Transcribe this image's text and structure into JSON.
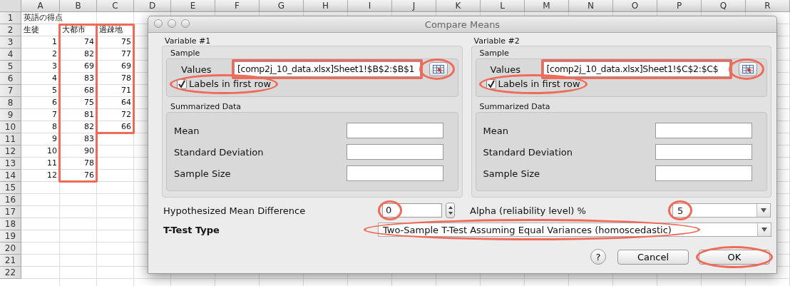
{
  "spreadsheet": {
    "columns": [
      {
        "label": "A",
        "marked": false
      },
      {
        "label": "B",
        "marked": true
      },
      {
        "label": "C",
        "marked": true
      },
      {
        "label": "D",
        "marked": false
      },
      {
        "label": "E",
        "marked": false
      },
      {
        "label": "F",
        "marked": false
      },
      {
        "label": "G",
        "marked": false
      },
      {
        "label": "H",
        "marked": false
      },
      {
        "label": "I",
        "marked": false
      },
      {
        "label": "J",
        "marked": false
      },
      {
        "label": "K",
        "marked": false
      },
      {
        "label": "L",
        "marked": false
      },
      {
        "label": "M",
        "marked": false
      },
      {
        "label": "N",
        "marked": false
      },
      {
        "label": "O",
        "marked": false
      },
      {
        "label": "P",
        "marked": false
      },
      {
        "label": "Q",
        "marked": false
      },
      {
        "label": "R",
        "marked": false
      }
    ],
    "rows": [
      {
        "header": "1",
        "kind": "text",
        "cells": [
          "英語の得点"
        ]
      },
      {
        "header": "2",
        "kind": "text",
        "cells": [
          "生徒",
          "大都市",
          "過疎地"
        ]
      },
      {
        "header": "3",
        "kind": "number",
        "cells": [
          "1",
          "74",
          "75"
        ]
      },
      {
        "header": "4",
        "kind": "number",
        "cells": [
          "2",
          "82",
          "77"
        ]
      },
      {
        "header": "5",
        "kind": "number",
        "cells": [
          "3",
          "69",
          "69"
        ]
      },
      {
        "header": "6",
        "kind": "number",
        "cells": [
          "4",
          "83",
          "78"
        ]
      },
      {
        "header": "7",
        "kind": "number",
        "cells": [
          "5",
          "68",
          "71"
        ]
      },
      {
        "header": "8",
        "kind": "number",
        "cells": [
          "6",
          "75",
          "64"
        ]
      },
      {
        "header": "9",
        "kind": "number",
        "cells": [
          "7",
          "81",
          "72"
        ]
      },
      {
        "header": "10",
        "kind": "number",
        "cells": [
          "8",
          "82",
          "66"
        ]
      },
      {
        "header": "11",
        "kind": "number",
        "cells": [
          "9",
          "83"
        ]
      },
      {
        "header": "12",
        "kind": "number",
        "cells": [
          "10",
          "90"
        ]
      },
      {
        "header": "13",
        "kind": "number",
        "cells": [
          "11",
          "78"
        ]
      },
      {
        "header": "14",
        "kind": "number",
        "cells": [
          "12",
          "76"
        ]
      },
      {
        "header": "15",
        "cells": []
      },
      {
        "header": "16",
        "cells": []
      },
      {
        "header": "17",
        "cells": []
      },
      {
        "header": "18",
        "cells": []
      },
      {
        "header": "19",
        "cells": []
      },
      {
        "header": "20",
        "cells": []
      },
      {
        "header": "21",
        "cells": []
      },
      {
        "header": "22",
        "cells": []
      }
    ]
  },
  "dialog": {
    "title": "Compare Means",
    "variables": [
      {
        "title": "Variable #1",
        "sample_title": "Sample",
        "values_label": "Values",
        "values": "[comp2j_10_data.xlsx]Sheet1!$B$2:$B$1",
        "values_highlighted": true,
        "picker_highlighted": true,
        "labels_checkbox": {
          "label": "Labels in first row",
          "checked": true,
          "highlighted": true
        },
        "summary_title": "Summarized Data",
        "summary_fields": [
          "Mean",
          "Standard Deviation",
          "Sample Size"
        ]
      },
      {
        "title": "Variable #2",
        "sample_title": "Sample",
        "values_label": "Values",
        "values": "[comp2j_10_data.xlsx]Sheet1!$C$2:$C$",
        "values_highlighted": true,
        "picker_highlighted": true,
        "labels_checkbox": {
          "label": "Labels in first row",
          "checked": true,
          "highlighted": true
        },
        "summary_title": "Summarized Data",
        "summary_fields": [
          "Mean",
          "Standard Deviation",
          "Sample Size"
        ]
      }
    ],
    "hypothesized": {
      "label": "Hypothesized Mean Difference",
      "value": "0",
      "highlighted": true
    },
    "alpha": {
      "label": "Alpha (reliability level) %",
      "value": "5",
      "highlighted": true
    },
    "ttest": {
      "label": "T-Test Type",
      "value": "Two-Sample T-Test Assuming Equal Variances (homoscedastic)",
      "highlighted": true
    },
    "help": "?",
    "buttons": [
      {
        "label": "Cancel",
        "highlighted": false
      },
      {
        "label": "OK",
        "highlighted": true
      }
    ]
  }
}
